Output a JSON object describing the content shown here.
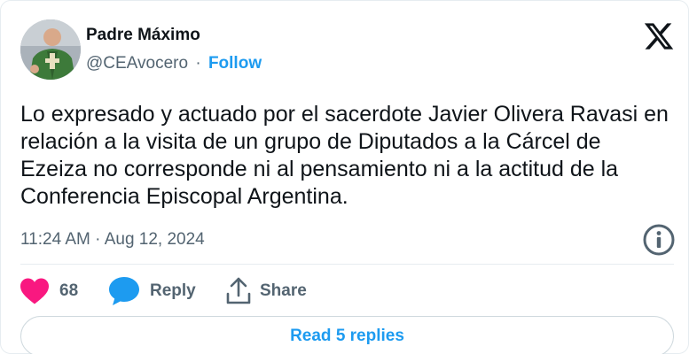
{
  "author": {
    "name": "Padre Máximo",
    "handle": "@CEAvocero",
    "separator": "·",
    "follow_label": "Follow"
  },
  "tweet": {
    "text": "Lo expresado y actuado por el sacerdote Javier Olivera Ravasi en relación a la visita de un grupo de Diputados a la Cárcel de Ezeiza no corresponde ni al pensamiento ni a la actitud de la Conferencia Episcopal Argentina.",
    "timestamp": "11:24 AM · Aug 12, 2024"
  },
  "actions": {
    "likes": "68",
    "reply_label": "Reply",
    "share_label": "Share"
  },
  "replies": {
    "button_label": "Read 5 replies"
  },
  "icons": {
    "brand": "x-logo-icon",
    "info": "info-icon",
    "like": "heart-icon",
    "reply": "speech-bubble-icon",
    "share": "share-icon"
  },
  "colors": {
    "accent": "#1d9bf0",
    "like": "#f91880",
    "text": "#0f1419",
    "muted": "#536471"
  }
}
